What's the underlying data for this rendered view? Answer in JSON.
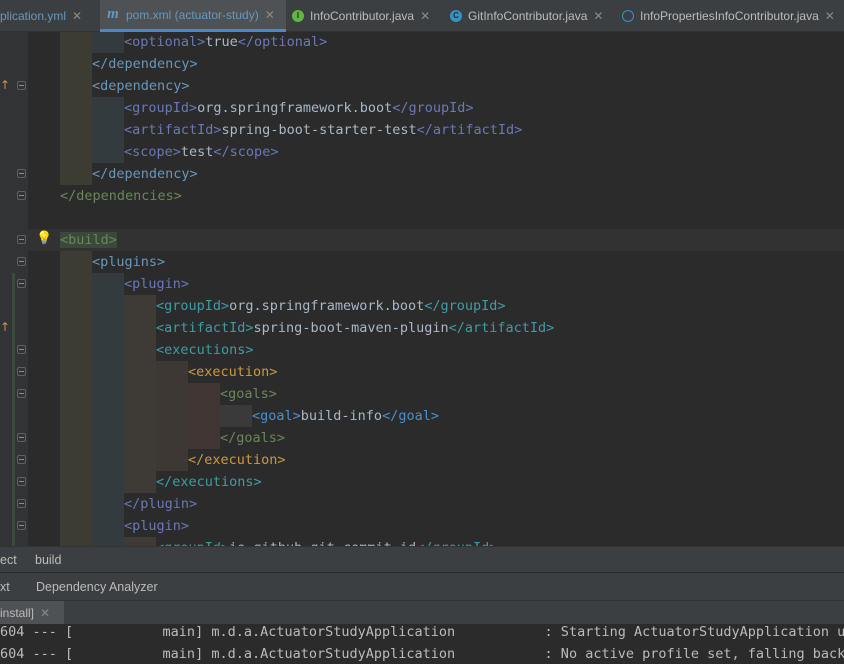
{
  "tabs": [
    {
      "label": "plication.yml",
      "icon": "yml-icon",
      "active": false,
      "closable": true
    },
    {
      "label": "pom.xml (actuator-study)",
      "icon": "maven-icon",
      "active": true,
      "closable": true
    },
    {
      "label": "InfoContributor.java",
      "icon": "interface-icon",
      "active": false,
      "closable": true
    },
    {
      "label": "GitInfoContributor.java",
      "icon": "class-icon",
      "active": false,
      "closable": true
    },
    {
      "label": "InfoPropertiesInfoContributor.java",
      "icon": "abstract-class-icon",
      "active": false,
      "closable": true
    }
  ],
  "code": {
    "lines": [
      {
        "indent": 2,
        "tag": "optional",
        "text": "true",
        "close": true
      },
      {
        "indent": 1,
        "tag": "/dependency"
      },
      {
        "indent": 1,
        "tag": "dependency"
      },
      {
        "indent": 2,
        "tag": "groupId",
        "text": "org.springframework.boot",
        "close": true
      },
      {
        "indent": 2,
        "tag": "artifactId",
        "text": "spring-boot-starter-test",
        "close": true
      },
      {
        "indent": 2,
        "tag": "scope",
        "text": "test",
        "close": true
      },
      {
        "indent": 1,
        "tag": "/dependency"
      },
      {
        "indent": 0,
        "tag": "/dependencies"
      },
      {
        "indent": 0,
        "tag": ""
      },
      {
        "indent": 0,
        "tag": "build"
      },
      {
        "indent": 1,
        "tag": "plugins"
      },
      {
        "indent": 2,
        "tag": "plugin"
      },
      {
        "indent": 3,
        "tag": "groupId",
        "text": "org.springframework.boot",
        "close": true
      },
      {
        "indent": 3,
        "tag": "artifactId",
        "text": "spring-boot-maven-plugin",
        "close": true
      },
      {
        "indent": 3,
        "tag": "executions"
      },
      {
        "indent": 4,
        "tag": "execution"
      },
      {
        "indent": 5,
        "tag": "goals"
      },
      {
        "indent": 6,
        "tag": "goal",
        "text": "build-info",
        "close": true
      },
      {
        "indent": 5,
        "tag": "/goals"
      },
      {
        "indent": 4,
        "tag": "/execution"
      },
      {
        "indent": 3,
        "tag": "/executions"
      },
      {
        "indent": 2,
        "tag": "/plugin"
      },
      {
        "indent": 2,
        "tag": "plugin"
      },
      {
        "indent": 3,
        "tag": "groupId",
        "text": "io.github.git-commit-id",
        "close": true
      }
    ]
  },
  "breadcrumb": {
    "items": [
      "ect",
      "build"
    ]
  },
  "tool_tabs": {
    "items": [
      "xt",
      "Dependency Analyzer"
    ]
  },
  "run": {
    "tab_label": "install]"
  },
  "console": {
    "lines": [
      "604 --- [           main] m.d.a.ActuatorStudyApplication           : Starting ActuatorStudyApplication usi",
      "604 --- [           main] m.d.a.ActuatorStudyApplication           : No active profile set, falling back t"
    ]
  },
  "colors": {
    "active_tab_accent": "#4a88c7",
    "background": "#2b2b2b"
  }
}
